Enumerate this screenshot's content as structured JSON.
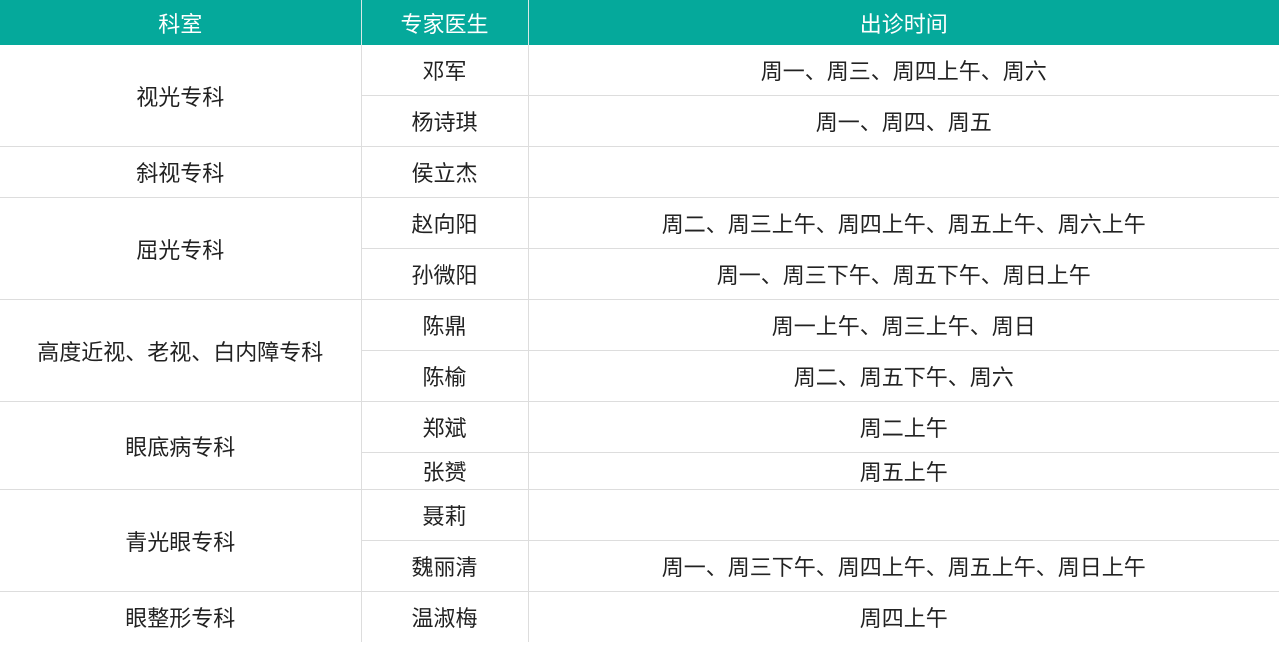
{
  "headers": {
    "dept": "科室",
    "doctor": "专家医生",
    "time": "出诊时间"
  },
  "departments": [
    {
      "name": "视光专科",
      "doctors": [
        {
          "name": "邓军",
          "time": "周一、周三、周四上午、周六"
        },
        {
          "name": "杨诗琪",
          "time": "周一、周四、周五"
        }
      ]
    },
    {
      "name": "斜视专科",
      "doctors": [
        {
          "name": "侯立杰",
          "time": ""
        }
      ]
    },
    {
      "name": "屈光专科",
      "doctors": [
        {
          "name": "赵向阳",
          "time": "周二、周三上午、周四上午、周五上午、周六上午"
        },
        {
          "name": "孙微阳",
          "time": "周一、周三下午、周五下午、周日上午"
        }
      ]
    },
    {
      "name": "高度近视、老视、白内障专科",
      "doctors": [
        {
          "name": "陈鼎",
          "time": "周一上午、周三上午、周日"
        },
        {
          "name": "陈榆",
          "time": "周二、周五下午、周六"
        }
      ]
    },
    {
      "name": "眼底病专科",
      "doctors": [
        {
          "name": "郑斌",
          "time": "周二上午"
        },
        {
          "name": "张赟",
          "time": "周五上午"
        }
      ]
    },
    {
      "name": "青光眼专科",
      "doctors": [
        {
          "name": "聂莉",
          "time": ""
        },
        {
          "name": "魏丽清",
          "time": "周一、周三下午、周四上午、周五上午、周日上午"
        }
      ]
    },
    {
      "name": "眼整形专科",
      "doctors": [
        {
          "name": "温淑梅",
          "time": "周四上午"
        }
      ]
    }
  ]
}
